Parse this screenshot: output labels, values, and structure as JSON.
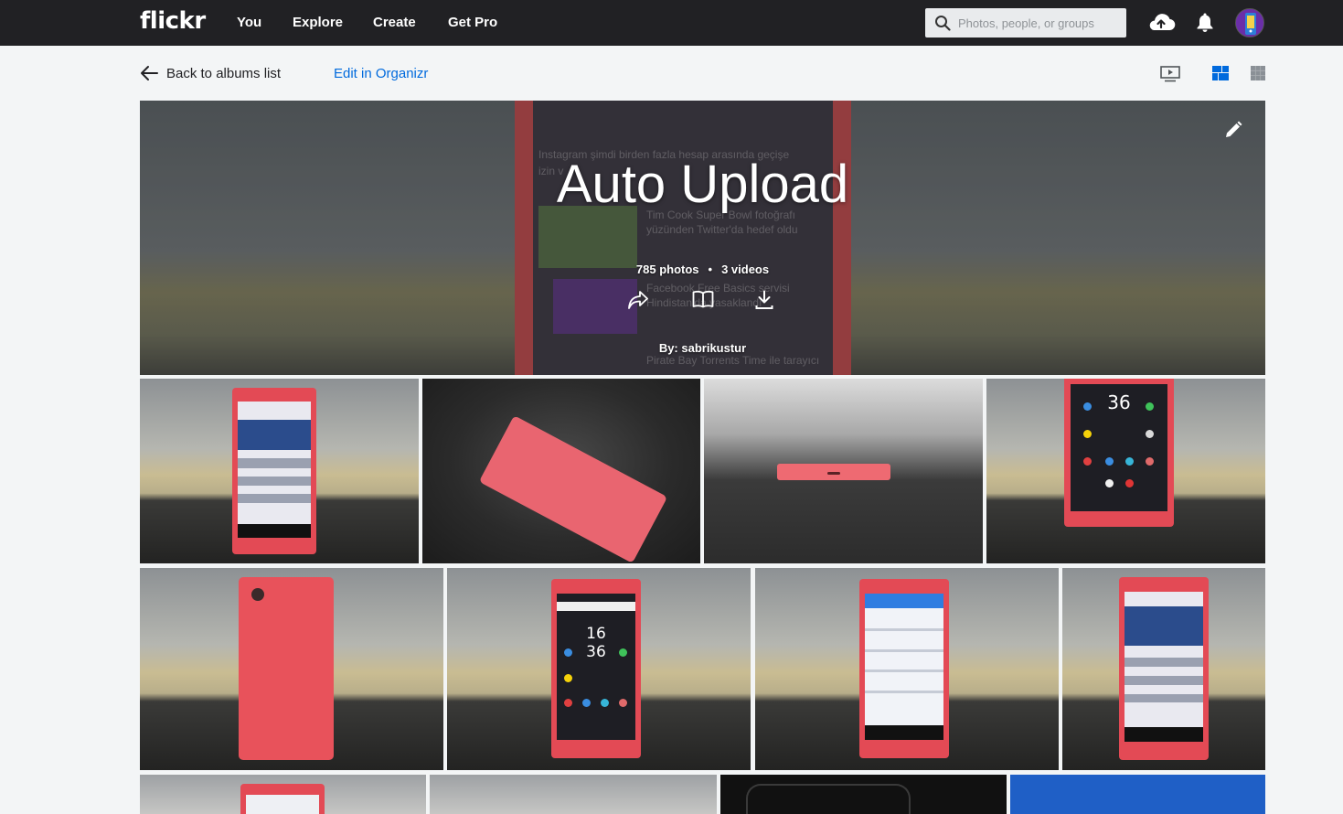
{
  "topnav": {
    "logo": "flickr",
    "links": [
      "You",
      "Explore",
      "Create",
      "Get Pro"
    ],
    "search_placeholder": "Photos, people, or groups"
  },
  "subbar": {
    "back_label": "Back to albums list",
    "edit_label": "Edit in Organizr"
  },
  "album": {
    "title": "Auto Upload",
    "photos": "785 photos",
    "separator": "•",
    "videos": "3 videos",
    "by": "By: sabrikustur",
    "background_text": [
      "Instagram şimdi birden fazla hesap arasında geçişe",
      "izin v",
      "Tim Cook Super Bowl fotoğrafı",
      "yüzünden Twitter'da hedef oldu",
      "Facebook Free Basics servisi",
      "Hindistan'da yasaklandı",
      "Pirate Bay Torrents Time ile tarayıcı"
    ]
  },
  "photos": [
    {
      "kind": "front-blog"
    },
    {
      "kind": "lying-back"
    },
    {
      "kind": "bottom-edge"
    },
    {
      "kind": "front-home"
    },
    {
      "kind": "back"
    },
    {
      "kind": "front-home"
    },
    {
      "kind": "front-settings"
    },
    {
      "kind": "front-blog"
    },
    {
      "kind": "front-partial"
    },
    {
      "kind": "grey"
    },
    {
      "kind": "black"
    },
    {
      "kind": "blue"
    }
  ],
  "colors": {
    "nav_bg": "#212124",
    "link_blue": "#006add",
    "page_bg": "#f3f5f6",
    "phone_red": "#e34a55"
  }
}
